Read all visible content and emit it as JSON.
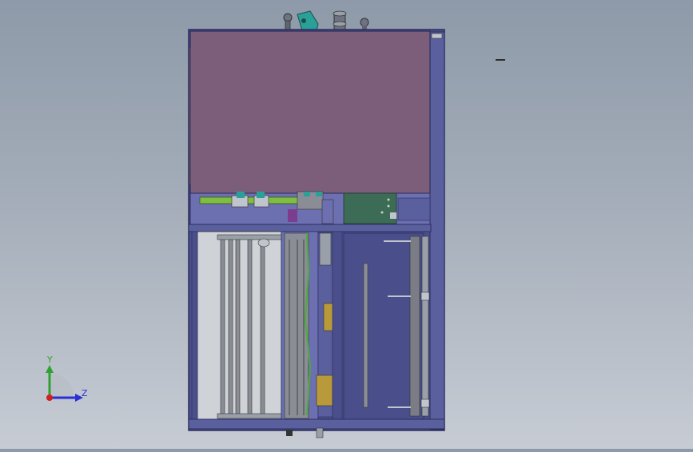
{
  "colors": {
    "background_top": "#8e9aa9",
    "background_bottom": "#c7ccd4",
    "frame": "#4a4f8c",
    "frame_dark": "#2c2f5e",
    "panel_top": "#7d5e7a",
    "panel_bottom": "#6c6fb0",
    "green_bar": "#7fbf3f",
    "green_board": "#3c6b56",
    "teal": "#2aa198",
    "interior_light": "#cfd2d6",
    "roller": "#8a8d95"
  },
  "triad": {
    "y_label": "Y",
    "z_label": "Z"
  },
  "icons": {
    "triad": "coordinate-triad-icon",
    "minimize": "minimize-icon"
  }
}
